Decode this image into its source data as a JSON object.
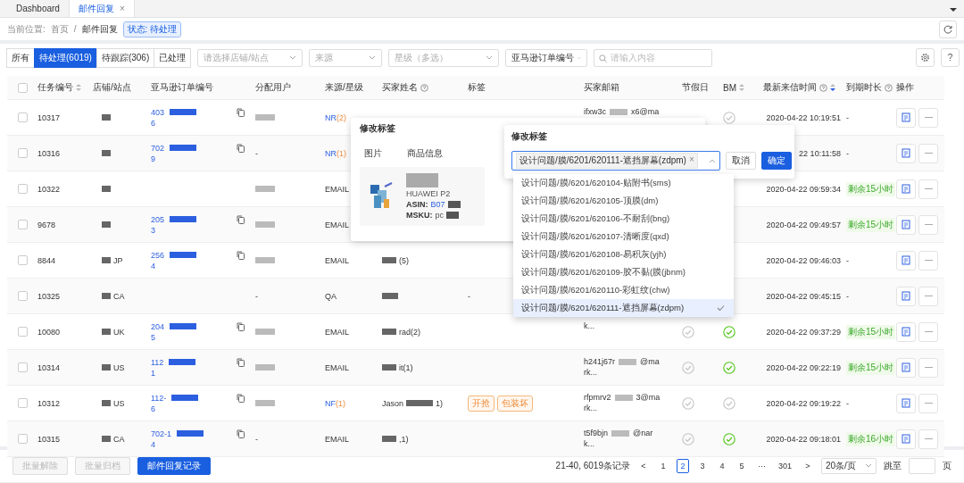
{
  "tabs": [
    {
      "label": "Dashboard",
      "selected": false
    },
    {
      "label": "邮件回复",
      "selected": true,
      "close": "×"
    }
  ],
  "breadcrumb": {
    "label": "当前位置:",
    "home": "首页",
    "separator": "/",
    "current": "邮件回复",
    "status_tag": "状态: 待处理"
  },
  "filters": {
    "segments": [
      {
        "label": "所有",
        "selected": false
      },
      {
        "label": "待处理(6019)",
        "selected": true
      },
      {
        "label": "待跟踪(306)",
        "selected": false
      },
      {
        "label": "已处理",
        "selected": false
      }
    ],
    "selects": [
      {
        "placeholder": "请选择店铺/站点"
      },
      {
        "placeholder": "来源"
      },
      {
        "placeholder": "星级（多选）"
      }
    ],
    "search_type": "亚马逊订单编号",
    "search_placeholder": "请输入内容",
    "help_button": "?"
  },
  "table": {
    "all_checked": false,
    "columns": [
      {
        "label": "任务编号",
        "sortable": true,
        "sort_desc": false
      },
      {
        "label": "店铺/站点"
      },
      {
        "label": "亚马逊订单编号"
      },
      {
        "label": "分配用户"
      },
      {
        "label": "来源/星级"
      },
      {
        "label": "买家姓名",
        "help": true
      },
      {
        "label": "标签"
      },
      {
        "label": "买家邮箱"
      },
      {
        "label": "节假日"
      },
      {
        "label": "BM",
        "sortable": true,
        "sort_desc": false
      },
      {
        "label": "最新来信时间",
        "help": true,
        "sortable": true,
        "sort_desc": true
      },
      {
        "label": "到期时长",
        "help": true
      },
      {
        "label": "操作"
      }
    ],
    "rows": [
      {
        "checked": false,
        "task": "10317",
        "store_redacted": true,
        "order": [
          "403",
          "6"
        ],
        "user_redacted": true,
        "source": "NR",
        "rating": "(2)",
        "email": [
          "ifxw3c",
          "x6@ma"
        ],
        "bm_checked": false,
        "time": "2020-04-22 10:19:51",
        "expiry": "-"
      },
      {
        "checked": false,
        "task": "10316",
        "store_redacted": true,
        "order": [
          "702",
          "9"
        ],
        "user": "-",
        "source": "NR",
        "rating": "(1)",
        "time": "22 10:11:58",
        "expiry": "-"
      },
      {
        "checked": false,
        "task": "10322",
        "store_redacted": true,
        "user_redacted": true,
        "source": "EMAIL",
        "time": "2020-04-22 09:59:34",
        "expiry": "剩余15小时"
      },
      {
        "checked": false,
        "task": "9678",
        "store_redacted": true,
        "order": [
          "205",
          "3"
        ],
        "user_redacted": true,
        "source": "EMAIL",
        "time": "2020-04-22 09:49:57",
        "expiry": "剩余15小时"
      },
      {
        "checked": false,
        "task": "8844",
        "store_redacted": true,
        "store": "JP",
        "order": [
          "256",
          "4"
        ],
        "user_redacted": true,
        "source": "EMAIL",
        "buyer": [
          "(5)"
        ],
        "time": "2020-04-22 09:46:03",
        "expiry": "-"
      },
      {
        "checked": false,
        "task": "10325",
        "store_redacted": true,
        "store": "CA",
        "user": "-",
        "source": "QA",
        "buyer_redacted": true,
        "tags_empty": "-",
        "time": "2020-04-22 09:45:15",
        "expiry": "-"
      },
      {
        "checked": false,
        "task": "10080",
        "store_redacted": true,
        "store": "UK",
        "order": [
          "204",
          "5"
        ],
        "user_redacted": true,
        "source": "EMAIL",
        "buyer": [
          "rad(2)"
        ],
        "email_more": "k...",
        "holiday_checked": false,
        "bm_checked": true,
        "time": "2020-04-22 09:37:29",
        "expiry": "剩余15小时"
      },
      {
        "checked": false,
        "task": "10314",
        "store_redacted": true,
        "store": "US",
        "order": [
          "112",
          "1"
        ],
        "user_redacted": true,
        "source": "EMAIL",
        "buyer": [
          "it(1)"
        ],
        "email": [
          "h241j67r",
          "@ma"
        ],
        "email_more": "rk...",
        "holiday_checked": false,
        "bm_checked": true,
        "time": "2020-04-22 09:22:19",
        "expiry": "剩余15小时"
      },
      {
        "checked": false,
        "task": "10312",
        "store_redacted": true,
        "store": "US",
        "order": [
          "112-",
          "6"
        ],
        "user_redacted": true,
        "source": "NF",
        "rating": "(1)",
        "buyer": [
          "Jason",
          "1)"
        ],
        "tags": [
          {
            "label": "开抢"
          },
          {
            "label": "包装坏"
          }
        ],
        "email": [
          "rfpmrv2",
          "3@ma"
        ],
        "email_more": "rk...",
        "holiday_checked": false,
        "bm_checked": false,
        "time": "2020-04-22 09:19:22",
        "expiry": "-"
      },
      {
        "checked": false,
        "task": "10315",
        "store_redacted": true,
        "store": "CA",
        "order": [
          "702-1",
          "4"
        ],
        "user": "-",
        "source": "EMAIL",
        "buyer": [
          ",1)"
        ],
        "email": [
          "t5f9bjn",
          "@nar"
        ],
        "email_more": "k...",
        "holiday_checked": false,
        "bm_checked": true,
        "time": "2020-04-22 09:18:01",
        "expiry": "剩余16小时"
      }
    ]
  },
  "product_popover": {
    "title": "修改标签",
    "columns": [
      "图片",
      "商品信息"
    ],
    "product_name": "HUAWEI P2",
    "asin_label": "ASIN:",
    "asin": "B07",
    "msku_label": "MSKU:",
    "msku": "pc"
  },
  "tag_popover": {
    "title": "修改标签",
    "selected_tag": "设计问题/膜/6201/620111-遮挡屏幕(zdpm)",
    "tag_close": "×",
    "cancel": "取消",
    "confirm": "确定",
    "options": [
      {
        "label": "设计问题/膜/6201/620104-贴附书(sms)",
        "selected": false
      },
      {
        "label": "设计问题/膜/6201/620105-顶膜(dm)",
        "selected": false
      },
      {
        "label": "设计问题/膜/6201/620106-不耐刮(bng)",
        "selected": false
      },
      {
        "label": "设计问题/膜/6201/620107-清晰度(qxd)",
        "selected": false
      },
      {
        "label": "设计问题/膜/6201/620108-易积灰(yjh)",
        "selected": false
      },
      {
        "label": "设计问题/膜/6201/620109-胶不黏(膜(jbnm)",
        "selected": false
      },
      {
        "label": "设计问题/膜/6201/620110-彩虹纹(chw)",
        "selected": false
      },
      {
        "label": "设计问题/膜/6201/620111-遮挡屏幕(zdpm)",
        "selected": true
      }
    ]
  },
  "footer": {
    "buttons": [
      {
        "label": "批量解除",
        "disabled": true
      },
      {
        "label": "批量归档",
        "disabled": true
      },
      {
        "label": "邮件回复记录",
        "disabled": false
      }
    ],
    "total": "21-40, 6019条记录",
    "prev": "<",
    "next": ">",
    "pages": [
      {
        "label": "1",
        "selected": false
      },
      {
        "label": "2",
        "selected": true
      },
      {
        "label": "3",
        "selected": false
      },
      {
        "label": "4",
        "selected": false
      },
      {
        "label": "5",
        "selected": false
      },
      {
        "label": "···",
        "selected": false
      },
      {
        "label": "301",
        "selected": false
      }
    ],
    "page_size": "20条/页",
    "jump_label": "跳至",
    "page_unit": "页"
  }
}
